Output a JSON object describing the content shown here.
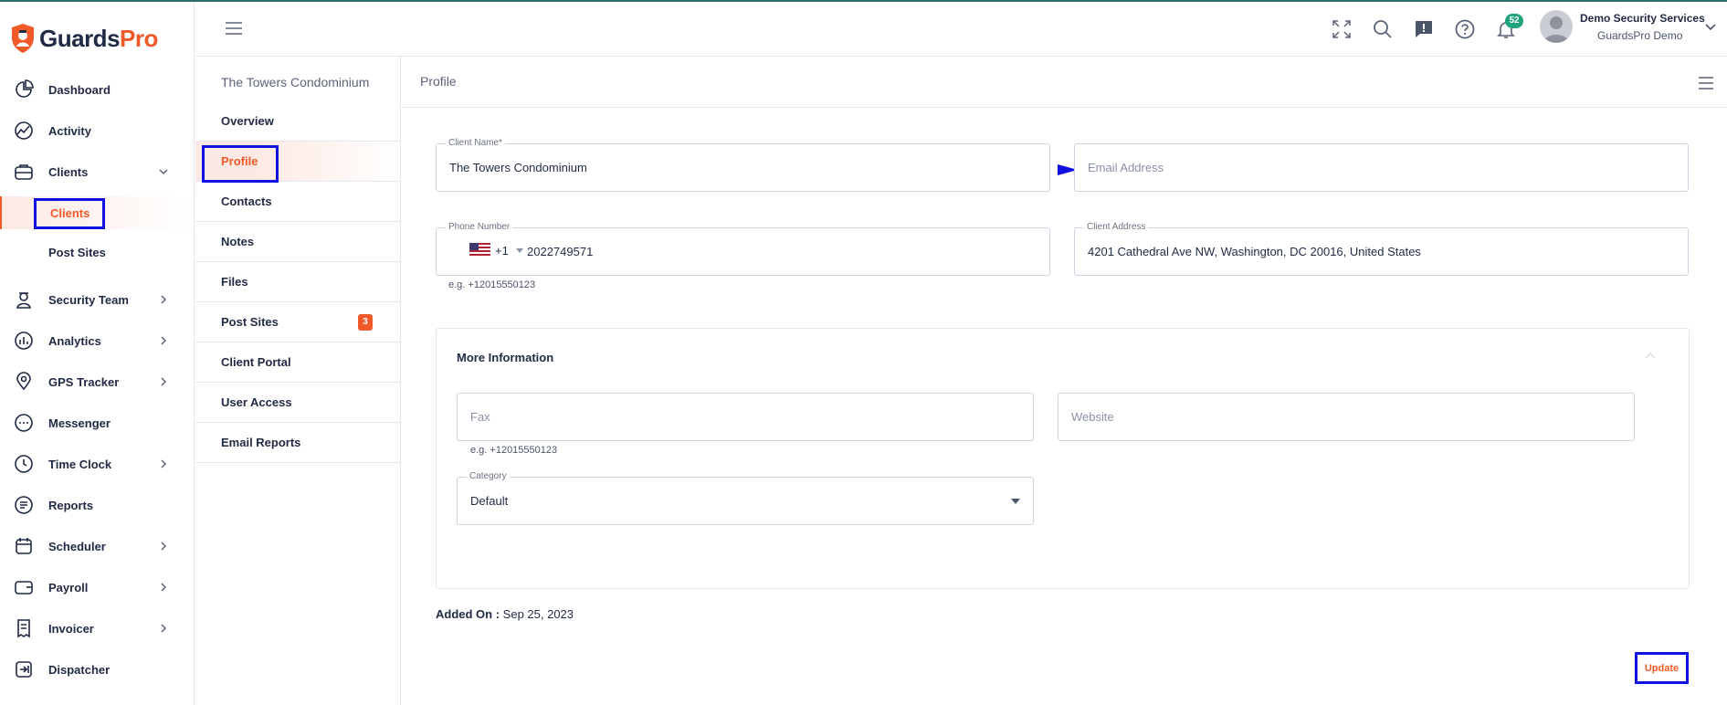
{
  "brand": {
    "name_part1": "Guards",
    "name_part2": "Pro",
    "accent": "#f05a28",
    "navy": "#1f2a44"
  },
  "sidebar": {
    "items": [
      {
        "label": "Dashboard",
        "icon": "dashboard-icon"
      },
      {
        "label": "Activity",
        "icon": "activity-icon"
      },
      {
        "label": "Clients",
        "icon": "briefcase-icon",
        "expanded": true
      },
      {
        "label": "Clients",
        "sub": true,
        "active": true
      },
      {
        "label": "Post Sites",
        "sub": true
      },
      {
        "label": "Security Team",
        "icon": "guard-icon"
      },
      {
        "label": "Analytics",
        "icon": "analytics-icon"
      },
      {
        "label": "GPS Tracker",
        "icon": "map-pin-icon"
      },
      {
        "label": "Messenger",
        "icon": "chat-icon"
      },
      {
        "label": "Time Clock",
        "icon": "clock-icon"
      },
      {
        "label": "Reports",
        "icon": "reports-icon"
      },
      {
        "label": "Scheduler",
        "icon": "calendar-icon"
      },
      {
        "label": "Payroll",
        "icon": "wallet-icon"
      },
      {
        "label": "Invoicer",
        "icon": "invoice-icon"
      },
      {
        "label": "Dispatcher",
        "icon": "dispatch-icon"
      }
    ]
  },
  "header": {
    "notification_count": "52",
    "user_name": "Demo Security Services",
    "user_company": "GuardsPro Demo"
  },
  "subnav": {
    "title": "The Towers Condominium",
    "items": [
      {
        "label": "Overview"
      },
      {
        "label": "Profile",
        "active": true
      },
      {
        "label": "Contacts"
      },
      {
        "label": "Notes"
      },
      {
        "label": "Files"
      },
      {
        "label": "Post Sites",
        "badge": "3"
      },
      {
        "label": "Client Portal"
      },
      {
        "label": "User Access"
      },
      {
        "label": "Email Reports"
      }
    ]
  },
  "main": {
    "title": "Profile",
    "client_name": {
      "label": "Client Name*",
      "value": "The Towers Condominium"
    },
    "email": {
      "placeholder": "Email Address"
    },
    "phone": {
      "label": "Phone Number",
      "dial_code": "+1",
      "value": "2022749571",
      "hint": "e.g. +12015550123"
    },
    "address": {
      "label": "Client Address",
      "value": "4201 Cathedral Ave NW, Washington, DC 20016, United States"
    },
    "more_info": {
      "title": "More Information",
      "fax": {
        "placeholder": "Fax",
        "hint": "e.g. +12015550123"
      },
      "website": {
        "placeholder": "Website"
      },
      "category": {
        "label": "Category",
        "value": "Default"
      }
    },
    "added_on_label": "Added On :",
    "added_on_value": "Sep 25, 2023",
    "update_label": "Update"
  }
}
